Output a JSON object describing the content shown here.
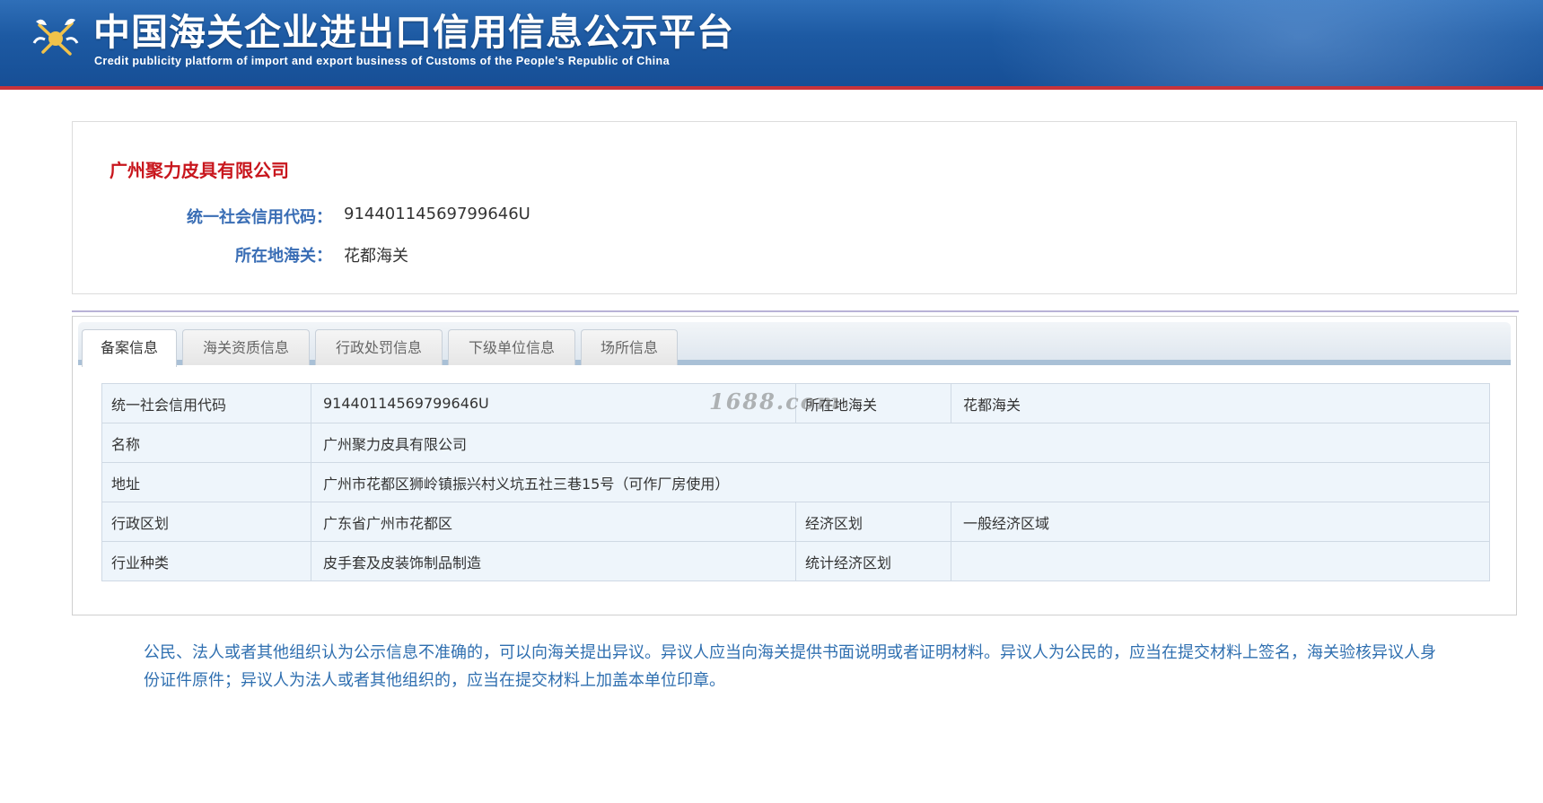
{
  "header": {
    "title": "中国海关企业进出口信用信息公示平台",
    "subtitle": "Credit publicity platform of import and export business of Customs of the People's Republic of China",
    "emblem_icon": "customs-emblem-icon"
  },
  "company": {
    "name": "广州聚力皮具有限公司",
    "credit_code_label": "统一社会信用代码：",
    "credit_code": "91440114569799646U",
    "customs_label": "所在地海关：",
    "customs": "花都海关"
  },
  "tabs": [
    {
      "label": "备案信息",
      "active": true
    },
    {
      "label": "海关资质信息",
      "active": false
    },
    {
      "label": "行政处罚信息",
      "active": false
    },
    {
      "label": "下级单位信息",
      "active": false
    },
    {
      "label": "场所信息",
      "active": false
    }
  ],
  "table": {
    "credit_code_label": "统一社会信用代码",
    "credit_code": "91440114569799646U",
    "customs_label": "所在地海关",
    "customs": "花都海关",
    "name_label": "名称",
    "name": "广州聚力皮具有限公司",
    "address_label": "地址",
    "address": "广州市花都区狮岭镇振兴村义坑五社三巷15号（可作厂房使用）",
    "division_label": "行政区划",
    "division": "广东省广州市花都区",
    "econ_zone_label": "经济区划",
    "econ_zone": "一般经济区域",
    "industry_label": "行业种类",
    "industry": "皮手套及皮装饰制品制造",
    "stat_zone_label": "统计经济区划",
    "stat_zone": ""
  },
  "watermark": "1688.com",
  "notice": "公民、法人或者其他组织认为公示信息不准确的，可以向海关提出异议。异议人应当向海关提供书面说明或者证明材料。异议人为公民的，应当在提交材料上签名，海关验核异议人身份证件原件；异议人为法人或者其他组织的，应当在提交材料上加盖本单位印章。",
  "colors": {
    "banner": "#1d5aa3",
    "company_name": "#c8161d",
    "label_blue": "#3a6eb5",
    "notice_blue": "#2f6fb0"
  }
}
